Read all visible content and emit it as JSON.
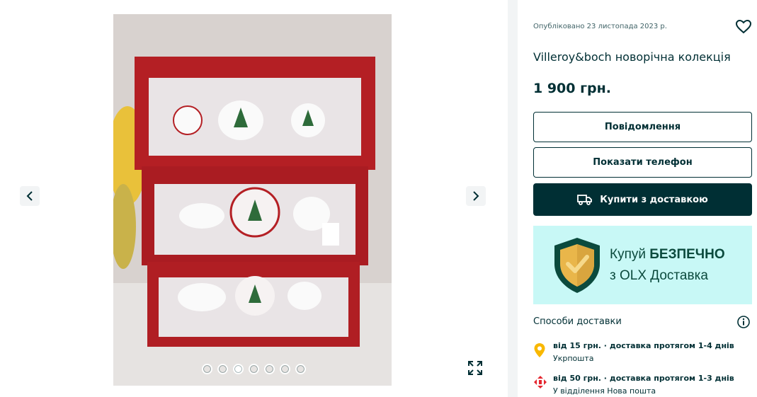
{
  "gallery": {
    "photo_alt": "",
    "prev_label": "previous-photo",
    "next_label": "next-photo",
    "photo_count": 7,
    "active_index": 2
  },
  "ad": {
    "published": "Опубліковано 23 листопада 2023 р.",
    "title": "Villeroy&boch новорічна колекція",
    "price": "1 900 грн."
  },
  "actions": {
    "message_label": "Повідомлення",
    "phone_label": "Показати телефон",
    "buy_label": "Купити з доставкою"
  },
  "banner": {
    "line1_prefix": "Купуй ",
    "line1_bold": "БЕЗПЕЧНО",
    "line2": "з OLX Доставка"
  },
  "delivery": {
    "heading": "Способи доставки",
    "options": [
      {
        "main": "від 15 грн. · доставка протягом 1-4 днів",
        "sub": "Укрпошта",
        "icon": "ukrposhta-icon",
        "color": "#f9b800"
      },
      {
        "main": "від 50 грн. · доставка протягом 1-3 днів",
        "sub": "У відділення Нова пошта",
        "icon": "nova-poshta-icon",
        "color": "#e4252e"
      }
    ]
  },
  "colors": {
    "primary": "#002f34",
    "banner_bg": "#c8f8f6",
    "banner_text": "#0b4a3d"
  }
}
